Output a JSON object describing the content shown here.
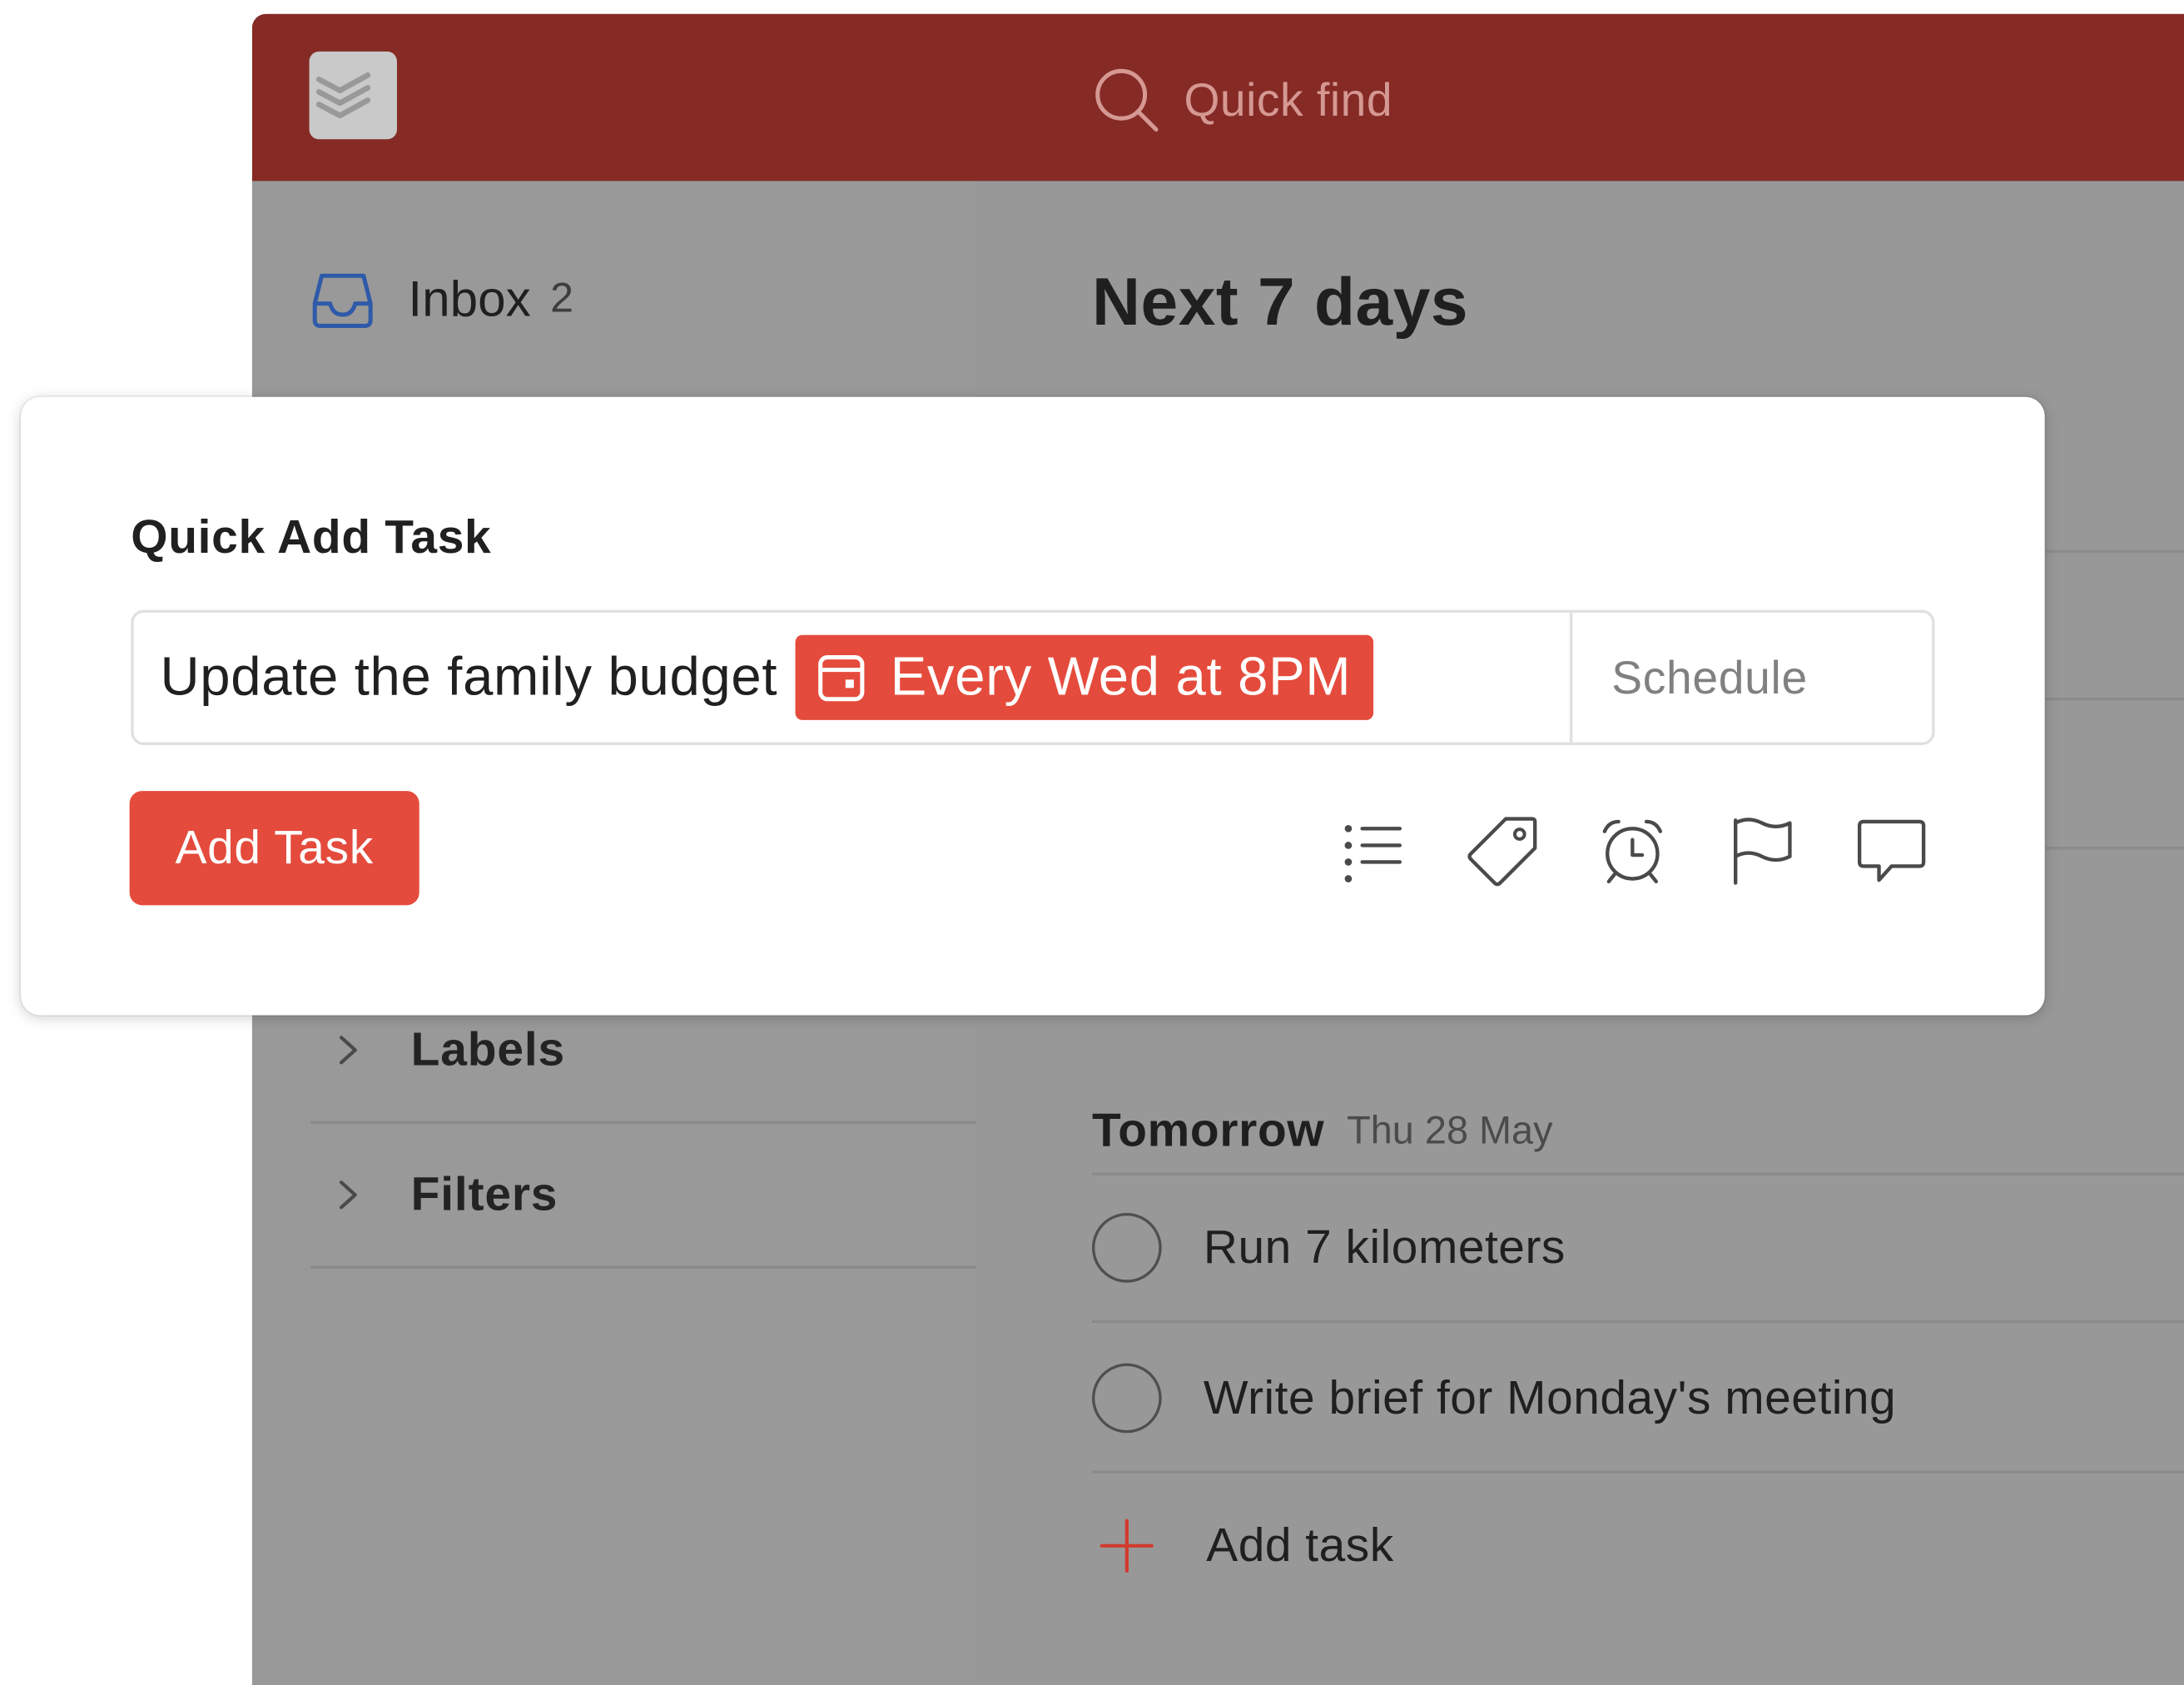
{
  "app": {
    "logo_icon": "todoist-logo-icon",
    "search_icon": "search-icon",
    "quick_find_placeholder": "Quick find",
    "colors": {
      "topbar": "#852a25",
      "accent": "#e44b3c",
      "overlay_gray": "#999999"
    }
  },
  "sidebar": {
    "inbox": {
      "label": "Inbox",
      "count": "2",
      "icon": "inbox-icon"
    },
    "sections": [
      {
        "label": "Labels",
        "icon": "chevron-right-icon"
      },
      {
        "label": "Filters",
        "icon": "chevron-right-icon"
      }
    ]
  },
  "main": {
    "title": "Next 7 days",
    "day": {
      "title": "Tomorrow",
      "date": "Thu 28 May"
    },
    "tasks": [
      {
        "text": "Run 7 kilometers"
      },
      {
        "text": "Write brief for Monday's meeting"
      }
    ],
    "add_task_label": "Add task"
  },
  "quick_add": {
    "title": "Quick Add Task",
    "task_text": "Update the family budget",
    "date_chip": "Every Wed at 8PM",
    "schedule_label": "Schedule",
    "add_button": "Add Task",
    "action_icons": [
      "project-list-icon",
      "label-tag-icon",
      "reminder-alarm-icon",
      "priority-flag-icon",
      "comment-icon"
    ]
  }
}
